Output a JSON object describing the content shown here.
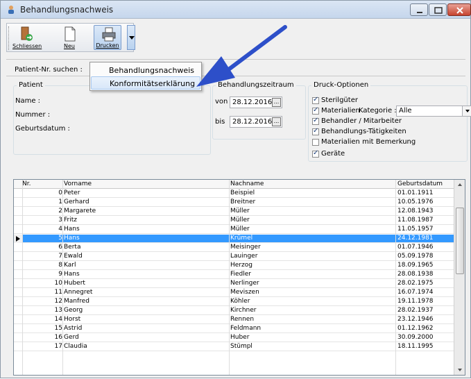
{
  "window": {
    "title": "Behandlungsnachweis"
  },
  "toolbar": {
    "close_label": "Schliessen",
    "new_label": "Neu",
    "print_label": "Drucken"
  },
  "search": {
    "label": "Patient-Nr. suchen :"
  },
  "print_menu": {
    "items": [
      "Behandlungsnachweis",
      "Konformitätserklärung"
    ]
  },
  "patient": {
    "title": "Patient",
    "name_label": "Name :",
    "number_label": "Nummer :",
    "birth_label": "Geburtsdatum :"
  },
  "period": {
    "title": "Behandlungszeitraum",
    "from_label": "von",
    "from_value": "28.12.2016",
    "to_label": "bis",
    "to_value": "28.12.2016",
    "picker_glyph": "..."
  },
  "print_options": {
    "title": "Druck-Optionen",
    "sterile": "Sterilgüter",
    "materials": "Materialien",
    "category_label": "Kategorie :",
    "category_value": "Alle",
    "practitioner": "Behandler / Mitarbeiter",
    "activities": "Behandlungs-Tätigkeiten",
    "materials_remark": "Materialien mit Bemerkung",
    "devices": "Geräte"
  },
  "grid": {
    "columns": [
      "Nr.",
      "Vorname",
      "Nachname",
      "Geburtsdatum"
    ],
    "rows": [
      {
        "nr": "0",
        "vorname": "Peter",
        "nachname": "Beispiel",
        "geb": "01.01.1911"
      },
      {
        "nr": "1",
        "vorname": "Gerhard",
        "nachname": "Breitner",
        "geb": "10.05.1976"
      },
      {
        "nr": "2",
        "vorname": "Margarete",
        "nachname": "Müller",
        "geb": "12.08.1943"
      },
      {
        "nr": "3",
        "vorname": "Fritz",
        "nachname": "Müller",
        "geb": "11.08.1987"
      },
      {
        "nr": "4",
        "vorname": "Hans",
        "nachname": "Müller",
        "geb": "11.05.1957"
      },
      {
        "nr": "5",
        "vorname": "Hans",
        "nachname": "Krümel",
        "geb": "24.12.1981"
      },
      {
        "nr": "6",
        "vorname": "Berta",
        "nachname": "Meisinger",
        "geb": "01.07.1946"
      },
      {
        "nr": "7",
        "vorname": "Ewald",
        "nachname": "Lauinger",
        "geb": "05.09.1978"
      },
      {
        "nr": "8",
        "vorname": "Karl",
        "nachname": "Herzog",
        "geb": "18.09.1965"
      },
      {
        "nr": "9",
        "vorname": "Hans",
        "nachname": "Fiedler",
        "geb": "28.08.1938"
      },
      {
        "nr": "10",
        "vorname": "Hubert",
        "nachname": "Nerlinger",
        "geb": "28.02.1975"
      },
      {
        "nr": "11",
        "vorname": "Annegret",
        "nachname": "Meviszen",
        "geb": "16.07.1974"
      },
      {
        "nr": "12",
        "vorname": "Manfred",
        "nachname": "Köhler",
        "geb": "19.11.1978"
      },
      {
        "nr": "13",
        "vorname": "Georg",
        "nachname": "Kirchner",
        "geb": "28.02.1937"
      },
      {
        "nr": "14",
        "vorname": "Horst",
        "nachname": "Rennen",
        "geb": "23.12.1946"
      },
      {
        "nr": "15",
        "vorname": "Astrid",
        "nachname": "Feldmann",
        "geb": "01.12.1962"
      },
      {
        "nr": "16",
        "vorname": "Gerd",
        "nachname": "Huber",
        "geb": "30.09.2000"
      },
      {
        "nr": "17",
        "vorname": "Claudia",
        "nachname": "Stümpl",
        "geb": "18.11.1995"
      }
    ],
    "selected_index": 5
  },
  "colors": {
    "selection": "#3399ff",
    "annotation_arrow": "#2d4fc9"
  }
}
